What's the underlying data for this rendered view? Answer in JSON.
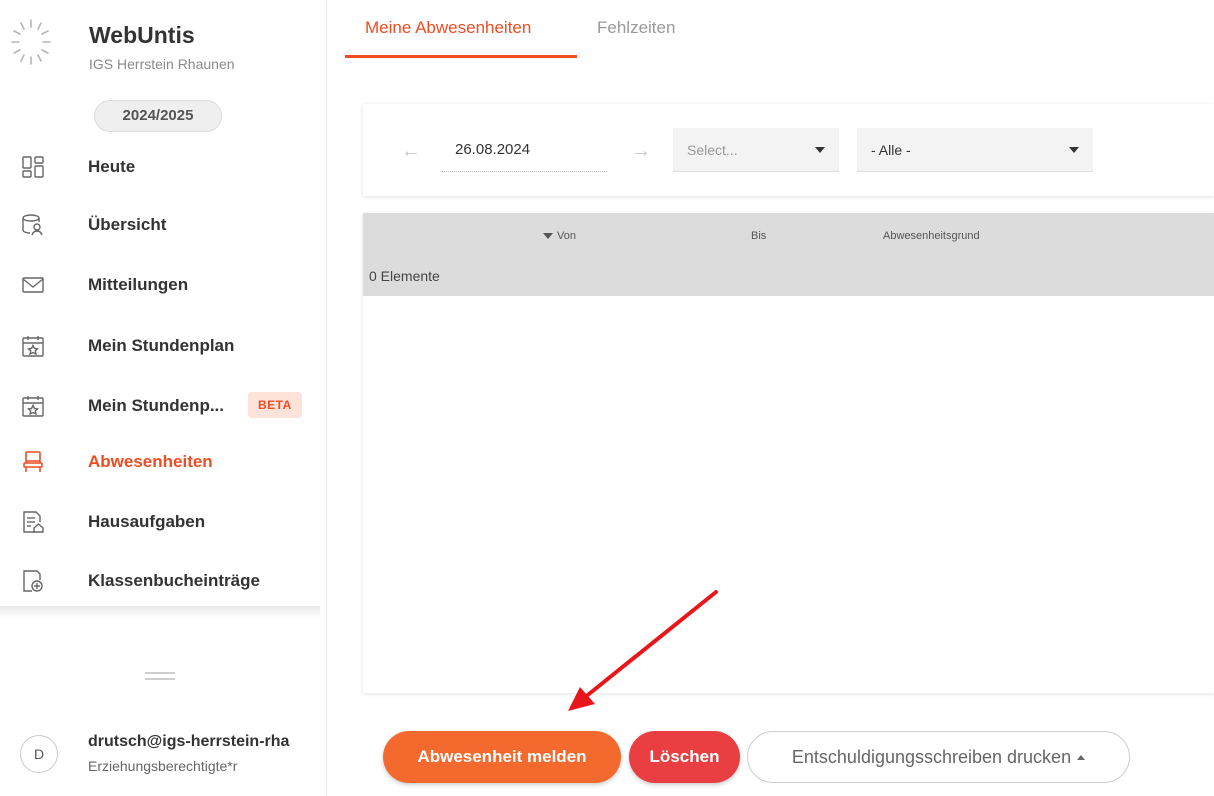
{
  "app": {
    "name": "WebUntis",
    "school": "IGS Herrstein Rhaunen",
    "school_year": "2024/2025"
  },
  "sidebar": {
    "items": [
      {
        "label": "Heute",
        "icon": "dashboard-icon"
      },
      {
        "label": "Übersicht",
        "icon": "overview-icon"
      },
      {
        "label": "Mitteilungen",
        "icon": "mail-icon"
      },
      {
        "label": "Mein Stundenplan",
        "icon": "calendar-star-icon"
      },
      {
        "label": "Mein Stundenp...",
        "icon": "calendar-star-icon",
        "badge": "BETA"
      },
      {
        "label": "Abwesenheiten",
        "icon": "chair-icon",
        "active": true
      },
      {
        "label": "Hausaufgaben",
        "icon": "homework-icon"
      },
      {
        "label": "Klassenbucheinträge",
        "icon": "classbook-add-icon"
      }
    ]
  },
  "user": {
    "initial": "D",
    "name": "drutsch@igs-herrstein-rha",
    "role": "Erziehungsberechtigte*r"
  },
  "tabs": [
    {
      "label": "Meine Abwesenheiten",
      "active": true
    },
    {
      "label": "Fehlzeiten",
      "active": false
    }
  ],
  "filters": {
    "date": "26.08.2024",
    "select_placeholder": "Select...",
    "category_value": "- Alle -"
  },
  "table": {
    "columns": [
      "Von",
      "Bis",
      "Abwesenheitsgrund"
    ],
    "row_count_label": "0 Elemente"
  },
  "actions": {
    "report_absence": "Abwesenheit melden",
    "delete": "Löschen",
    "print_excuse": "Entschuldigungsschreiben drucken"
  },
  "colors": {
    "accent": "#f14c21",
    "primary_button": "#f46a2e",
    "danger_button": "#ea3f42",
    "annotation_arrow": "#e8161a"
  }
}
